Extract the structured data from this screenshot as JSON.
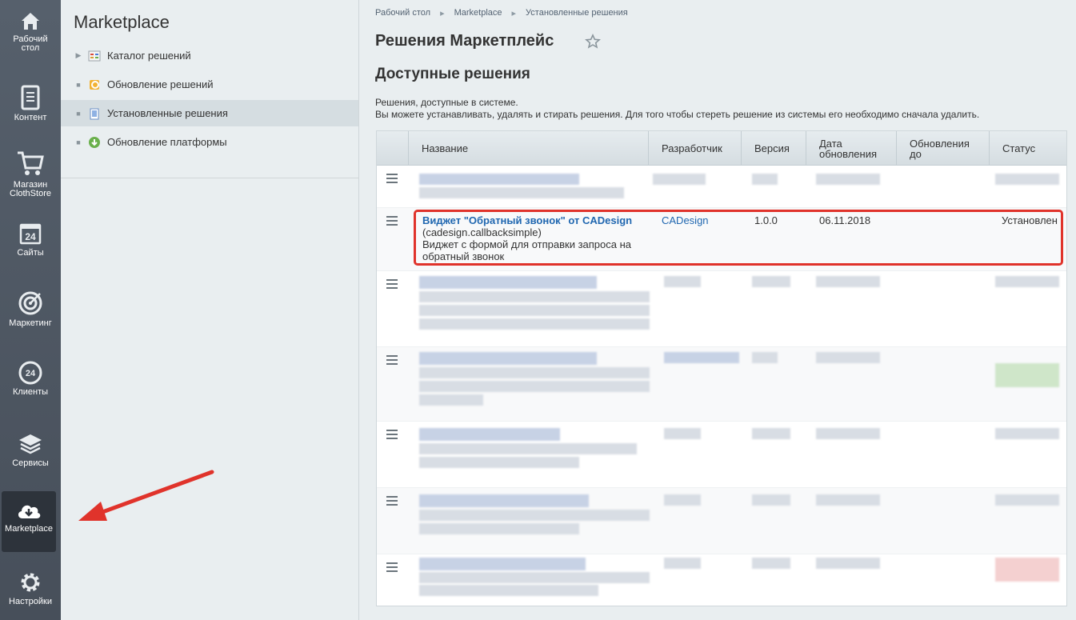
{
  "leftbar": {
    "items": [
      {
        "label": "Рабочий\nстол",
        "icon": "home-icon"
      },
      {
        "label": "Контент",
        "icon": "document-icon"
      },
      {
        "label": "Магазин\nClothStore",
        "icon": "cart-icon"
      },
      {
        "label": "Сайты",
        "icon": "calendar-icon"
      },
      {
        "label": "Маркетинг",
        "icon": "target-icon"
      },
      {
        "label": "Клиенты",
        "icon": "clients-icon"
      },
      {
        "label": "Сервисы",
        "icon": "layers-icon"
      },
      {
        "label": "Marketplace",
        "icon": "cloud-download-icon"
      },
      {
        "label": "Настройки",
        "icon": "gear-icon"
      }
    ]
  },
  "menu": {
    "title": "Marketplace",
    "items": [
      {
        "label": "Каталог решений",
        "marker": "▶"
      },
      {
        "label": "Обновление решений",
        "marker": "■"
      },
      {
        "label": "Установленные решения",
        "marker": "■"
      },
      {
        "label": "Обновление платформы",
        "marker": "■"
      }
    ]
  },
  "breadcrumb": {
    "items": [
      "Рабочий стол",
      "Marketplace",
      "Установленные решения"
    ],
    "separator": "▸"
  },
  "page": {
    "title": "Решения Маркетплейс",
    "section_title": "Доступные решения",
    "desc_line1": "Решения, доступные в системе.",
    "desc_line2": "Вы можете устанавливать, удалять и стирать решения. Для того чтобы стереть решение из системы его необходимо сначала удалить."
  },
  "table": {
    "headers": {
      "name": "Название",
      "developer": "Разработчик",
      "version": "Версия",
      "date": "Дата обновления",
      "updates": "Обновления до",
      "status": "Статус"
    },
    "highlighted_row": {
      "name": "Виджет \"Обратный звонок\" от CADesign",
      "code": "(cadesign.callbacksimple)",
      "description": "Виджет с формой для отправки запроса на обратный звонок",
      "developer": "CADesign",
      "version": "1.0.0",
      "date": "06.11.2018",
      "status": "Установлен"
    }
  },
  "colors": {
    "leftbar_bg": "#4c5561",
    "accent_link": "#2067b0",
    "highlight_border": "#e0332b"
  }
}
